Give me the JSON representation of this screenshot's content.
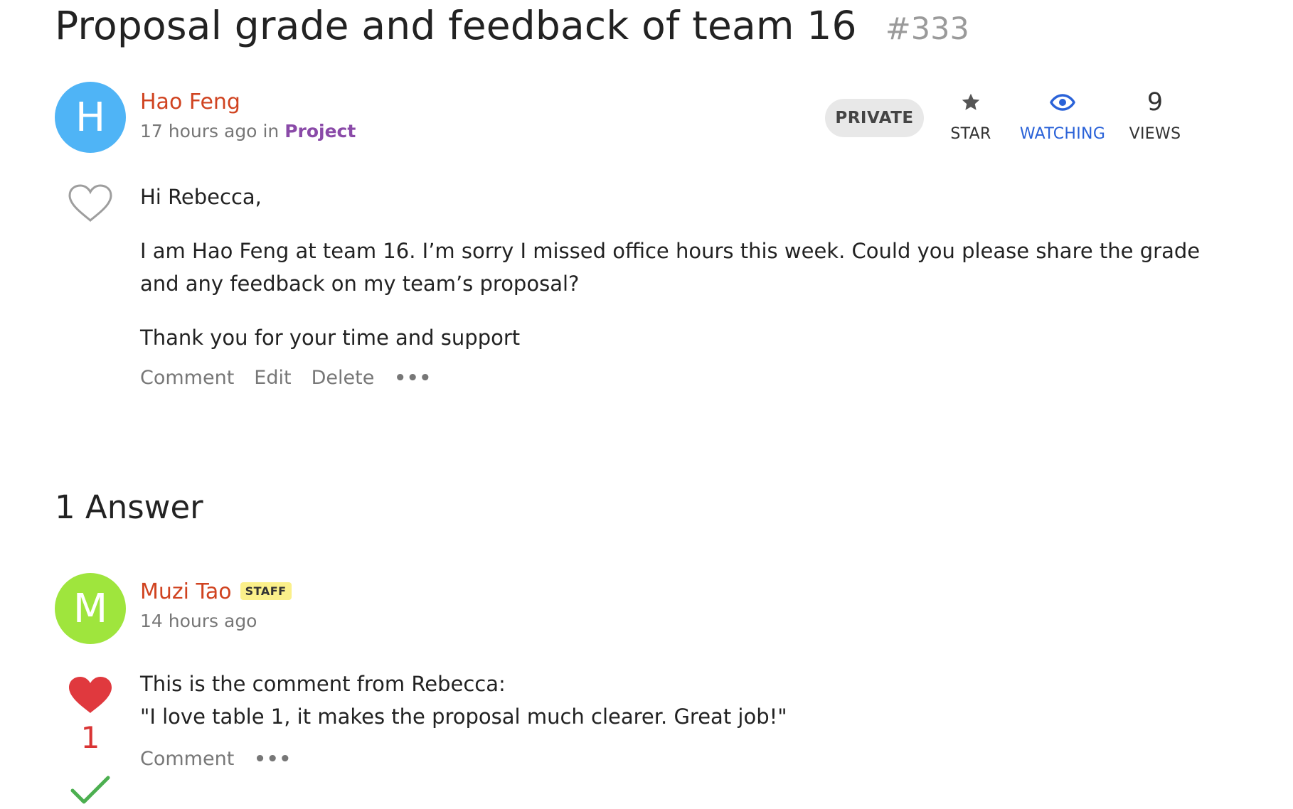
{
  "thread": {
    "title": "Proposal grade and feedback of team 16",
    "number": "#333"
  },
  "question": {
    "avatar_initial": "H",
    "author": "Hao Feng",
    "time": "17 hours ago",
    "in_word": "in",
    "category": "Project",
    "visibility": "PRIVATE",
    "star_label": "STAR",
    "watching_label": "WATCHING",
    "views_count": "9",
    "views_label": "VIEWS",
    "paragraphs": [
      "Hi Rebecca,",
      "I am Hao Feng at team 16. I’m sorry I missed office hours this week. Could you please share the grade and any feedback on my team’s proposal?",
      "Thank you for your time and support"
    ],
    "actions": {
      "comment": "Comment",
      "edit": "Edit",
      "delete": "Delete",
      "more": "•••"
    }
  },
  "answers": {
    "heading": "1 Answer",
    "items": [
      {
        "avatar_initial": "M",
        "author": "Muzi Tao",
        "badge": "STAFF",
        "time": "14 hours ago",
        "like_count": "1",
        "lines": [
          "This is the comment from Rebecca:",
          "\"I love table 1, it makes the proposal much clearer. Great job!\""
        ],
        "actions": {
          "comment": "Comment",
          "more": "•••"
        }
      }
    ]
  },
  "colors": {
    "author_name": "#d04320",
    "category": "#8a4aa8",
    "watching": "#2a62d8",
    "heart_filled": "#e0393e",
    "accepted_check": "#4caf50",
    "avatar_question": "#4fb4f6",
    "avatar_answer": "#9fe53d"
  },
  "icons": {
    "star": "star-icon",
    "watching": "eye-icon",
    "like_outline": "heart-outline-icon",
    "like_filled": "heart-filled-icon",
    "accepted": "checkmark-icon"
  }
}
